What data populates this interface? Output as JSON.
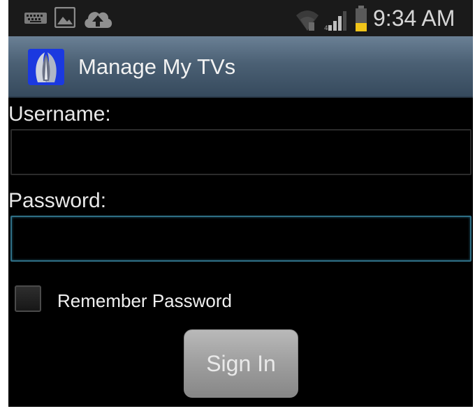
{
  "status_bar": {
    "time": "9:34 AM",
    "icons": [
      "keyboard-icon",
      "image-icon",
      "cloud-upload-icon",
      "wifi-icon",
      "signal-icon",
      "battery-icon"
    ]
  },
  "action_bar": {
    "title": "Manage My TVs",
    "icon": "app-icon"
  },
  "form": {
    "username_label": "Username:",
    "username_value": "",
    "password_label": "Password:",
    "password_value": "",
    "remember_label": "Remember Password",
    "remember_checked": false,
    "signin_label": "Sign In"
  },
  "colors": {
    "background": "#000000",
    "action_bar": "#4b6074",
    "focus_border": "#2f6f86",
    "battery_level": "#f0c419",
    "button": "#9e9e9e"
  }
}
